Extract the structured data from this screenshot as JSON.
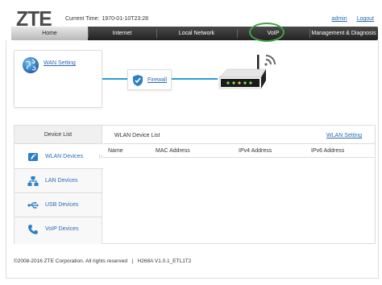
{
  "header": {
    "logo": "ZTE",
    "current_time_label": "Current Time:",
    "current_time_value": "1970-01-10T23:28",
    "admin_link": "admin",
    "logout_link": "Logout"
  },
  "nav": {
    "items": [
      {
        "label": "Home"
      },
      {
        "label": "Internet"
      },
      {
        "label": "Local Network"
      },
      {
        "label": "VoIP"
      },
      {
        "label": "Management & Diagnosis"
      }
    ],
    "active": "Home",
    "highlight_color": "#3ca83c"
  },
  "topology": {
    "wan_setting": "WAN Setting",
    "firewall": "Firewall",
    "line_color": "#2a9bd6"
  },
  "device_list": {
    "header": "Device List",
    "items": [
      {
        "label": "WLAN Devices",
        "icon": "wifi-icon"
      },
      {
        "label": "LAN Devices",
        "icon": "lan-icon"
      },
      {
        "label": "USB Devices",
        "icon": "usb-icon"
      },
      {
        "label": "VoIP Devices",
        "icon": "phone-icon"
      }
    ],
    "selected": "WLAN Devices"
  },
  "wlan_panel": {
    "title": "WLAN Device List",
    "setting_link": "WLAN Setting",
    "columns": [
      "Name",
      "MAC Address",
      "IPv4 Address",
      "IPv6 Address"
    ],
    "rows": []
  },
  "footer": {
    "copyright": "©2008-2016 ZTE Corporation. All rights reserved",
    "separator": "|",
    "model": "H268A V1.0.1_ETL1T2"
  },
  "colors": {
    "link": "#2a6ab5",
    "nav_bg": "#333333",
    "accent_blue": "#2a9bd6"
  }
}
